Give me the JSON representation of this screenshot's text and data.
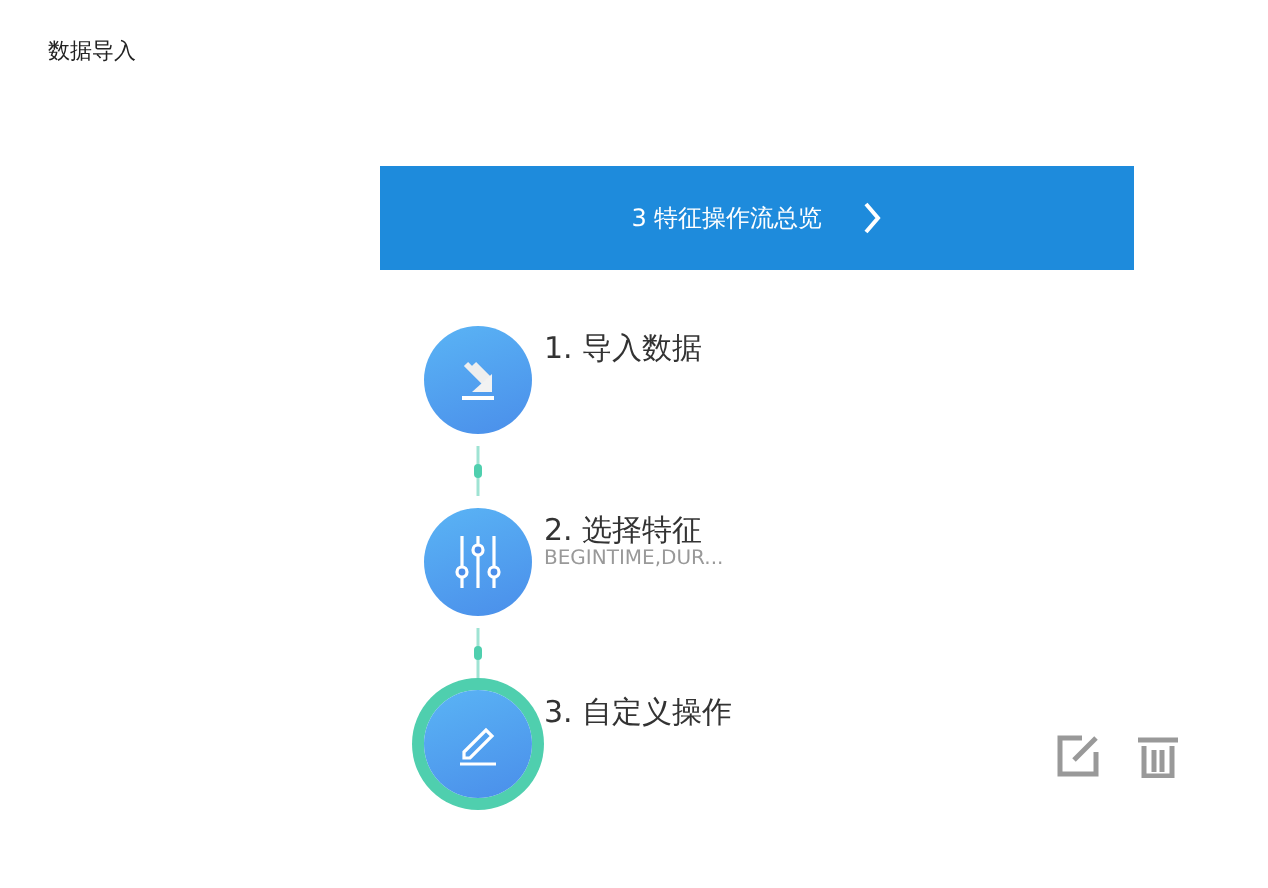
{
  "page_title": "数据导入",
  "banner": {
    "count": "3",
    "title": "特征操作流总览"
  },
  "steps": [
    {
      "kind": "import",
      "title": "1. 导入数据",
      "selected": false
    },
    {
      "kind": "filter",
      "title": "2. 选择特征",
      "subtitle": "BEGINTIME,DUR...",
      "selected": false
    },
    {
      "kind": "edit",
      "title": "3. 自定义操作",
      "selected": true
    }
  ]
}
